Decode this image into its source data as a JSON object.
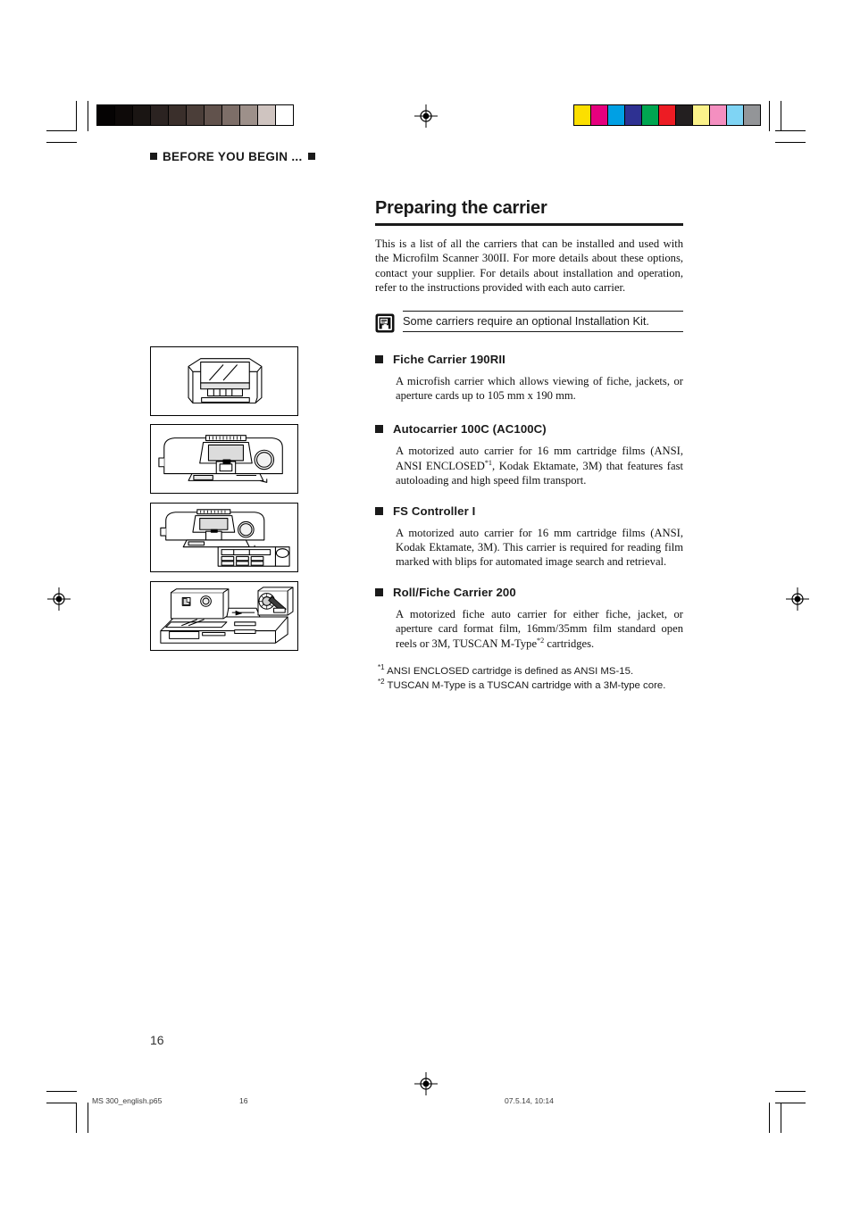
{
  "running_head": {
    "text": "BEFORE YOU BEGIN ...",
    "bullet_icon": "filled-square-icon"
  },
  "calibration": {
    "gray_swatches": [
      "#050303",
      "#0e0a09",
      "#1a1513",
      "#2b2321",
      "#3a2f2b",
      "#4b3e39",
      "#61524c",
      "#7d6e68",
      "#9d908a",
      "#cfc4c0",
      "#ffffff"
    ],
    "color_swatches": [
      "#fcdf00",
      "#e6007e",
      "#00a0e4",
      "#2e3192",
      "#00a651",
      "#ed1c24",
      "#231f20",
      "#fbf28a",
      "#f48fc0",
      "#7fd4f4",
      "#939598"
    ]
  },
  "main": {
    "title": "Preparing the carrier",
    "intro": "This is a list of all the carriers that can be installed and used with the Microfilm Scanner 300II. For more details about these options, contact your supplier. For details about installation and operation, refer to the instructions provided with each auto carrier.",
    "note": {
      "icon": "scanner-note-icon",
      "text": "Some carriers require an optional Installation Kit."
    },
    "sections": [
      {
        "heading": "Fiche Carrier 190RII",
        "body": "A microfish carrier which allows viewing of fiche, jackets, or aperture cards up to 105 mm x 190 mm.",
        "figure": "fiche-carrier-190rii-figure"
      },
      {
        "heading": "Autocarrier 100C (AC100C)",
        "body_part1": "A motorized auto carrier for 16 mm cartridge films (ANSI, ANSI ENCLOSED",
        "body_sup1": "*1",
        "body_part2": ", Kodak Ektamate, 3M) that features fast autoloading and high speed film transport.",
        "figure": "autocarrier-100c-figure"
      },
      {
        "heading": "FS Controller I",
        "body": "A motorized auto carrier for 16 mm cartridge films (ANSI, Kodak Ektamate, 3M). This carrier is required for reading film marked with blips for automated image search and retrieval.",
        "figure": "fs-controller-i-figure"
      },
      {
        "heading": "Roll/Fiche Carrier 200",
        "body_part1": "A motorized fiche auto carrier for either fiche, jacket, or aperture card format film, 16mm/35mm film standard open reels or 3M, TUSCAN M-Type",
        "body_sup1": "*2",
        "body_part2": " cartridges.",
        "figure": "roll-fiche-carrier-200-figure"
      }
    ],
    "footnotes": [
      {
        "marker": "*1",
        "text": " ANSI ENCLOSED cartridge is defined as ANSI MS-15."
      },
      {
        "marker": "*2",
        "text": " TUSCAN M-Type is a TUSCAN cartridge with a 3M-type core."
      }
    ]
  },
  "page_number": "16",
  "print_footer": {
    "file": "MS 300_english.p65",
    "page": "16",
    "date": "07.5.14, 10:14"
  }
}
